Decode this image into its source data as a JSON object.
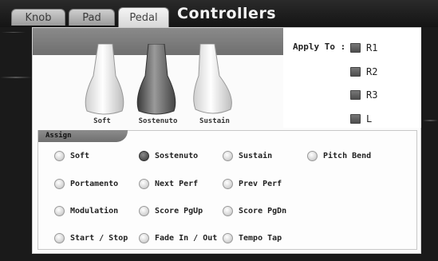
{
  "tabs": [
    {
      "label": "Knob",
      "active": false
    },
    {
      "label": "Pad",
      "active": false
    },
    {
      "label": "Pedal",
      "active": true
    }
  ],
  "title": "Controllers",
  "apply_to": {
    "label": "Apply To :",
    "items": [
      {
        "label": "R1"
      },
      {
        "label": "R2"
      },
      {
        "label": "R3"
      },
      {
        "label": "L"
      }
    ]
  },
  "pedals": [
    {
      "label": "Soft",
      "selected": false
    },
    {
      "label": "Sostenuto",
      "selected": true
    },
    {
      "label": "Sustain",
      "selected": false
    }
  ],
  "assign": {
    "label": "Assign",
    "options": [
      {
        "label": "Soft",
        "selected": false
      },
      {
        "label": "Sostenuto",
        "selected": true
      },
      {
        "label": "Sustain",
        "selected": false
      },
      {
        "label": "Pitch Bend",
        "selected": false
      },
      {
        "label": "Portamento",
        "selected": false
      },
      {
        "label": "Next Perf",
        "selected": false
      },
      {
        "label": "Prev Perf",
        "selected": false
      },
      {
        "label": "Modulation",
        "selected": false
      },
      {
        "label": "Score PgUp",
        "selected": false
      },
      {
        "label": "Score PgDn",
        "selected": false
      },
      {
        "label": "Start / Stop",
        "selected": false
      },
      {
        "label": "Fade In / Out",
        "selected": false
      },
      {
        "label": "Tempo Tap",
        "selected": false
      }
    ]
  },
  "colors": {
    "selected_fill": "#555555",
    "panel_bg": "#fbfbfb",
    "strip": "#7a7a7a"
  }
}
